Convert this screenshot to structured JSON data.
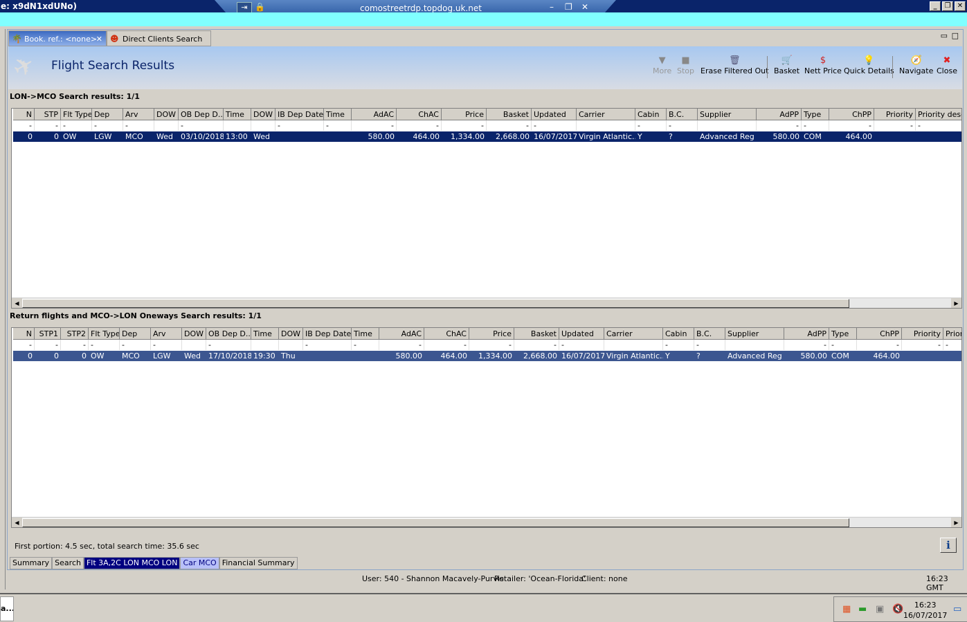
{
  "window": {
    "title": "e: x9dN1xdUNo)",
    "rdp_host": "comostreetrdp.topdog.uk.net"
  },
  "tabs": [
    {
      "label": "Book. ref.: <none>",
      "icon": "palm-tree-icon"
    },
    {
      "label": "Direct Clients Search",
      "icon": "person-icon"
    }
  ],
  "header": {
    "title": "Flight Search Results"
  },
  "toolbar": [
    {
      "label": "More",
      "icon": "triangle-down-icon",
      "enabled": false
    },
    {
      "label": "Stop",
      "icon": "stop-icon",
      "enabled": false
    },
    {
      "label": "Erase Filtered Out",
      "icon": "erase-bin-icon",
      "enabled": true
    },
    {
      "label": "Basket",
      "icon": "cart-icon",
      "enabled": true
    },
    {
      "label": "Nett Price",
      "icon": "money-icon",
      "enabled": true
    },
    {
      "label": "Quick Details",
      "icon": "lightbulb-icon",
      "enabled": true
    },
    {
      "label": "Navigate",
      "icon": "compass-icon",
      "enabled": true
    },
    {
      "label": "Close",
      "icon": "close-icon",
      "enabled": true
    }
  ],
  "outbound": {
    "title": "LON->MCO Search results: 1/1",
    "columns": [
      "N",
      "STP",
      "Flt Type",
      "Dep",
      "Arv",
      "DOW",
      "OB Dep D...",
      "Time",
      "DOW",
      "IB Dep Date",
      "Time",
      "AdAC",
      "ChAC",
      "Price",
      "Basket",
      "Updated",
      "Carrier",
      "Cabin",
      "B.C.",
      "Supplier",
      "AdPP",
      "Type",
      "ChPP",
      "Priority",
      "Priority descr"
    ],
    "filter": [
      "-",
      "-",
      "-",
      "-",
      "-",
      "",
      "-",
      "",
      "",
      "-",
      "-",
      "-",
      "-",
      "-",
      "-",
      "-",
      "",
      "-",
      "-",
      "",
      "-",
      "-",
      "-",
      "-",
      "-"
    ],
    "rows": [
      [
        "0",
        "0",
        "OW",
        "LGW",
        "MCO",
        "Wed",
        "03/10/2018",
        "13:00",
        "Wed",
        "",
        "",
        "580.00",
        "464.00",
        "1,334.00",
        "2,668.00",
        "16/07/2017",
        "Virgin Atlantic...",
        "Y",
        "?",
        "Advanced Reg",
        "580.00",
        "COM",
        "464.00",
        "",
        ""
      ]
    ]
  },
  "return": {
    "title": "Return flights and MCO->LON Oneways Search results: 1/1",
    "columns": [
      "N",
      "STP1",
      "STP2",
      "Flt Type",
      "Dep",
      "Arv",
      "DOW",
      "OB Dep D...",
      "Time",
      "DOW",
      "IB Dep Date",
      "Time",
      "AdAC",
      "ChAC",
      "Price",
      "Basket",
      "Updated",
      "Carrier",
      "Cabin",
      "B.C.",
      "Supplier",
      "AdPP",
      "Type",
      "ChPP",
      "Priority",
      "Prior"
    ],
    "filter": [
      "-",
      "-",
      "-",
      "-",
      "-",
      "-",
      "",
      "-",
      "",
      "",
      "-",
      "-",
      "-",
      "-",
      "-",
      "-",
      "-",
      "",
      "-",
      "-",
      "",
      "-",
      "-",
      "-",
      "-",
      "-"
    ],
    "rows": [
      [
        "0",
        "0",
        "0",
        "OW",
        "MCO",
        "LGW",
        "Wed",
        "17/10/2018",
        "19:30",
        "Thu",
        "",
        "",
        "580.00",
        "464.00",
        "1,334.00",
        "2,668.00",
        "16/07/2017",
        "Virgin Atlantic...",
        "Y",
        "?",
        "Advanced Reg",
        "580.00",
        "COM",
        "464.00",
        "",
        ""
      ]
    ]
  },
  "status": {
    "text": "First portion: 4.5 sec, total search time: 35.6 sec"
  },
  "bottom_tabs": [
    "Summary",
    "Search",
    "Flt 3A,2C LON MCO LON",
    "Car MCO",
    "Financial Summary"
  ],
  "userbar": {
    "user": "User: 540 - Shannon Macavely-Purvis",
    "retailer": "Retailer: 'Ocean-Florida'",
    "client": "Client: none",
    "time": "16:23 GMT"
  },
  "taskbar": {
    "item": "a...",
    "clock_time": "16:23",
    "clock_date": "16/07/2017"
  }
}
